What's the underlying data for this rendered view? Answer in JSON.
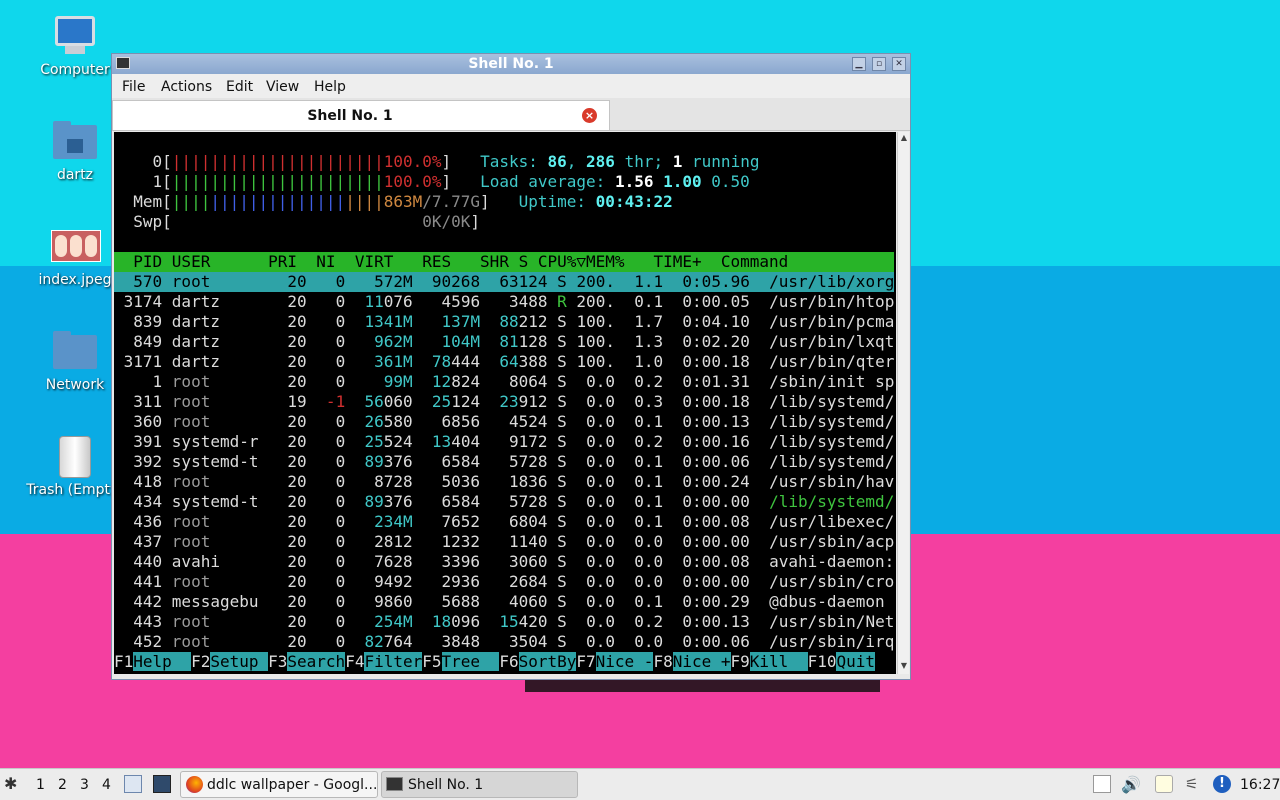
{
  "desktop": {
    "icons": [
      {
        "label": "Computer",
        "icon": "computer-icon"
      },
      {
        "label": "dartz",
        "icon": "home-folder-icon"
      },
      {
        "label": "index.jpeg",
        "icon": "image-file-icon"
      },
      {
        "label": "Network",
        "icon": "network-folder-icon"
      },
      {
        "label": "Trash (Empty)",
        "icon": "trash-icon"
      }
    ]
  },
  "window": {
    "title": "Shell No. 1",
    "menu": [
      "File",
      "Actions",
      "Edit",
      "View",
      "Help"
    ],
    "tab_label": "Shell No. 1"
  },
  "htop": {
    "meters": {
      "cpu0_label": "0[",
      "cpu0_bars": "||||||||||||||||||||||",
      "cpu0_value": "100.0%",
      "cpu1_label": "1[",
      "cpu1_bars": "||||||||||||||||||||||",
      "cpu1_value": "100.0%",
      "mem_label": "Mem[",
      "mem_green": "||||",
      "mem_blue": "||||||||||||||",
      "mem_orange": "||||",
      "mem_used": "863M",
      "mem_total": "/7.77G",
      "swp_label": "Swp[",
      "swp_value": "0K/0K",
      "close_bracket": "]"
    },
    "summary": {
      "tasks_label": "Tasks:",
      "tasks_count": "86",
      "threads": "286",
      "thr_label": "thr;",
      "running_count": "1",
      "running_label": "running",
      "load_label": "Load average:",
      "load1": "1.56",
      "load5": "1.00",
      "load15": "0.50",
      "uptime_label": "Uptime:",
      "uptime": "00:43:22"
    },
    "header": "  PID USER      PRI  NI  VIRT   RES   SHR S CPU%▽MEM%   TIME+  Command",
    "rows": [
      {
        "pid": "570",
        "user": "root",
        "pri": "20",
        "ni": "0",
        "virt": "572M",
        "res": "90268",
        "shr": "63124",
        "s": "S",
        "cpu": "200.",
        "mem": "1.1",
        "time": "0:05.96",
        "cmd": "/usr/lib/xorg"
      },
      {
        "pid": "3174",
        "user": "dartz",
        "pri": "20",
        "ni": "0",
        "virt": "11076",
        "res": "4596",
        "shr": "3488",
        "s": "R",
        "cpu": "200.",
        "mem": "0.1",
        "time": "0:00.05",
        "cmd": "/usr/bin/htop"
      },
      {
        "pid": "839",
        "user": "dartz",
        "pri": "20",
        "ni": "0",
        "virt": "1341M",
        "res": "137M",
        "shr": "88212",
        "s": "S",
        "cpu": "100.",
        "mem": "1.7",
        "time": "0:04.10",
        "cmd": "/usr/bin/pcma"
      },
      {
        "pid": "849",
        "user": "dartz",
        "pri": "20",
        "ni": "0",
        "virt": "962M",
        "res": "104M",
        "shr": "81128",
        "s": "S",
        "cpu": "100.",
        "mem": "1.3",
        "time": "0:02.20",
        "cmd": "/usr/bin/lxqt"
      },
      {
        "pid": "3171",
        "user": "dartz",
        "pri": "20",
        "ni": "0",
        "virt": "361M",
        "res": "78444",
        "shr": "64388",
        "s": "S",
        "cpu": "100.",
        "mem": "1.0",
        "time": "0:00.18",
        "cmd": "/usr/bin/qter"
      },
      {
        "pid": "1",
        "user": "root",
        "pri": "20",
        "ni": "0",
        "virt": "99M",
        "res": "12824",
        "shr": "8064",
        "s": "S",
        "cpu": "0.0",
        "mem": "0.2",
        "time": "0:01.31",
        "cmd": "/sbin/init sp"
      },
      {
        "pid": "311",
        "user": "root",
        "pri": "19",
        "ni": "-1",
        "virt": "56060",
        "res": "25124",
        "shr": "23912",
        "s": "S",
        "cpu": "0.0",
        "mem": "0.3",
        "time": "0:00.18",
        "cmd": "/lib/systemd/"
      },
      {
        "pid": "360",
        "user": "root",
        "pri": "20",
        "ni": "0",
        "virt": "26580",
        "res": "6856",
        "shr": "4524",
        "s": "S",
        "cpu": "0.0",
        "mem": "0.1",
        "time": "0:00.13",
        "cmd": "/lib/systemd/"
      },
      {
        "pid": "391",
        "user": "systemd-r",
        "pri": "20",
        "ni": "0",
        "virt": "25524",
        "res": "13404",
        "shr": "9172",
        "s": "S",
        "cpu": "0.0",
        "mem": "0.2",
        "time": "0:00.16",
        "cmd": "/lib/systemd/"
      },
      {
        "pid": "392",
        "user": "systemd-t",
        "pri": "20",
        "ni": "0",
        "virt": "89376",
        "res": "6584",
        "shr": "5728",
        "s": "S",
        "cpu": "0.0",
        "mem": "0.1",
        "time": "0:00.06",
        "cmd": "/lib/systemd/"
      },
      {
        "pid": "418",
        "user": "root",
        "pri": "20",
        "ni": "0",
        "virt": "8728",
        "res": "5036",
        "shr": "1836",
        "s": "S",
        "cpu": "0.0",
        "mem": "0.1",
        "time": "0:00.24",
        "cmd": "/usr/sbin/hav"
      },
      {
        "pid": "434",
        "user": "systemd-t",
        "pri": "20",
        "ni": "0",
        "virt": "89376",
        "res": "6584",
        "shr": "5728",
        "s": "S",
        "cpu": "0.0",
        "mem": "0.1",
        "time": "0:00.00",
        "cmd": "/lib/systemd/"
      },
      {
        "pid": "436",
        "user": "root",
        "pri": "20",
        "ni": "0",
        "virt": "234M",
        "res": "7652",
        "shr": "6804",
        "s": "S",
        "cpu": "0.0",
        "mem": "0.1",
        "time": "0:00.08",
        "cmd": "/usr/libexec/"
      },
      {
        "pid": "437",
        "user": "root",
        "pri": "20",
        "ni": "0",
        "virt": "2812",
        "res": "1232",
        "shr": "1140",
        "s": "S",
        "cpu": "0.0",
        "mem": "0.0",
        "time": "0:00.00",
        "cmd": "/usr/sbin/acp"
      },
      {
        "pid": "440",
        "user": "avahi",
        "pri": "20",
        "ni": "0",
        "virt": "7628",
        "res": "3396",
        "shr": "3060",
        "s": "S",
        "cpu": "0.0",
        "mem": "0.0",
        "time": "0:00.08",
        "cmd": "avahi-daemon:"
      },
      {
        "pid": "441",
        "user": "root",
        "pri": "20",
        "ni": "0",
        "virt": "9492",
        "res": "2936",
        "shr": "2684",
        "s": "S",
        "cpu": "0.0",
        "mem": "0.0",
        "time": "0:00.00",
        "cmd": "/usr/sbin/cro"
      },
      {
        "pid": "442",
        "user": "messagebu",
        "pri": "20",
        "ni": "0",
        "virt": "9860",
        "res": "5688",
        "shr": "4060",
        "s": "S",
        "cpu": "0.0",
        "mem": "0.1",
        "time": "0:00.29",
        "cmd": "@dbus-daemon"
      },
      {
        "pid": "443",
        "user": "root",
        "pri": "20",
        "ni": "0",
        "virt": "254M",
        "res": "18096",
        "shr": "15420",
        "s": "S",
        "cpu": "0.0",
        "mem": "0.2",
        "time": "0:00.13",
        "cmd": "/usr/sbin/Net"
      },
      {
        "pid": "452",
        "user": "root",
        "pri": "20",
        "ni": "0",
        "virt": "82764",
        "res": "3848",
        "shr": "3504",
        "s": "S",
        "cpu": "0.0",
        "mem": "0.0",
        "time": "0:00.06",
        "cmd": "/usr/sbin/irq"
      }
    ],
    "fkeys": [
      {
        "key": "F1",
        "label": "Help  "
      },
      {
        "key": "F2",
        "label": "Setup "
      },
      {
        "key": "F3",
        "label": "Search"
      },
      {
        "key": "F4",
        "label": "Filter"
      },
      {
        "key": "F5",
        "label": "Tree  "
      },
      {
        "key": "F6",
        "label": "SortBy"
      },
      {
        "key": "F7",
        "label": "Nice -"
      },
      {
        "key": "F8",
        "label": "Nice +"
      },
      {
        "key": "F9",
        "label": "Kill  "
      },
      {
        "key": "F10",
        "label": "Quit"
      }
    ]
  },
  "taskbar": {
    "workspaces": [
      "1",
      "2",
      "3",
      "4"
    ],
    "windows": [
      {
        "label": "ddlc wallpaper - Googl...",
        "icon": "firefox-icon"
      },
      {
        "label": "Shell No. 1",
        "icon": "terminal-icon"
      }
    ],
    "clock": "16:27"
  }
}
